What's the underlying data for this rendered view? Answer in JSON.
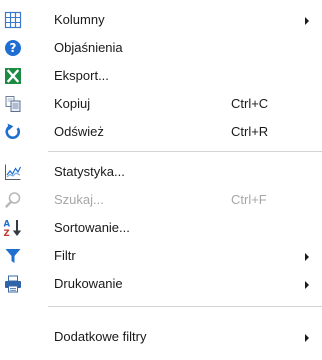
{
  "menu": {
    "items": [
      {
        "label": "Kolumny",
        "icon": "columns-icon",
        "submenu": true
      },
      {
        "label": "Objaśnienia",
        "icon": "help-icon"
      },
      {
        "label": "Eksport...",
        "icon": "excel-export-icon"
      },
      {
        "label": "Kopiuj",
        "icon": "copy-icon",
        "shortcut": "Ctrl+C"
      },
      {
        "label": "Odśwież",
        "icon": "refresh-icon",
        "shortcut": "Ctrl+R"
      },
      {
        "label": "Statystyka...",
        "icon": "statistics-chart-icon"
      },
      {
        "label": "Szukaj...",
        "icon": "search-icon",
        "shortcut": "Ctrl+F",
        "disabled": true
      },
      {
        "label": "Sortowanie...",
        "icon": "sort-az-icon"
      },
      {
        "label": "Filtr",
        "icon": "filter-icon",
        "submenu": true
      },
      {
        "label": "Drukowanie",
        "icon": "printer-icon",
        "submenu": true
      },
      {
        "label": "Dodatkowe filtry",
        "icon": "",
        "submenu": true
      }
    ]
  },
  "colors": {
    "text": "#1a1a1a",
    "disabled_text": "#a6a6a6",
    "separator": "#d4d4d4",
    "accent_blue": "#1e6fd0",
    "excel_green": "#1d8a45"
  }
}
